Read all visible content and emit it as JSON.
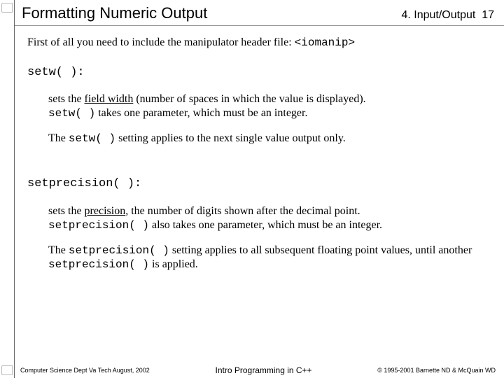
{
  "header": {
    "title": "Formatting Numeric Output",
    "chapter": "4. Input/Output",
    "page": "17"
  },
  "intro": {
    "lead": "First of all you need to include the manipulator header file: ",
    "code": "<iomanip>"
  },
  "setw": {
    "heading": "setw( ):",
    "line1_pre": "sets the ",
    "line1_u": "field width",
    "line1_post": " (number of spaces in which the value is displayed).",
    "line2_code": "setw( )",
    "line2_post": " takes one parameter, which must be an integer.",
    "line3_pre": "The ",
    "line3_code": "setw( )",
    "line3_post": " setting applies to the next single value output only."
  },
  "setprecision": {
    "heading": "setprecision( ):",
    "line1_pre": "sets the ",
    "line1_u": "precision",
    "line1_post": ", the number of digits shown after the decimal point.",
    "line2_code": "setprecision( )",
    "line2_post": " also takes one parameter, which must be an integer.",
    "line3_pre": "The ",
    "line3_code": "setprecision( )",
    "line3_mid": " setting applies to all subsequent floating point values, until another ",
    "line3_code2": "setprecision( )",
    "line3_post": " is applied."
  },
  "footer": {
    "left": "Computer Science Dept Va Tech  August, 2002",
    "center": "Intro Programming in C++",
    "right": "© 1995-2001  Barnette ND & McQuain WD"
  }
}
